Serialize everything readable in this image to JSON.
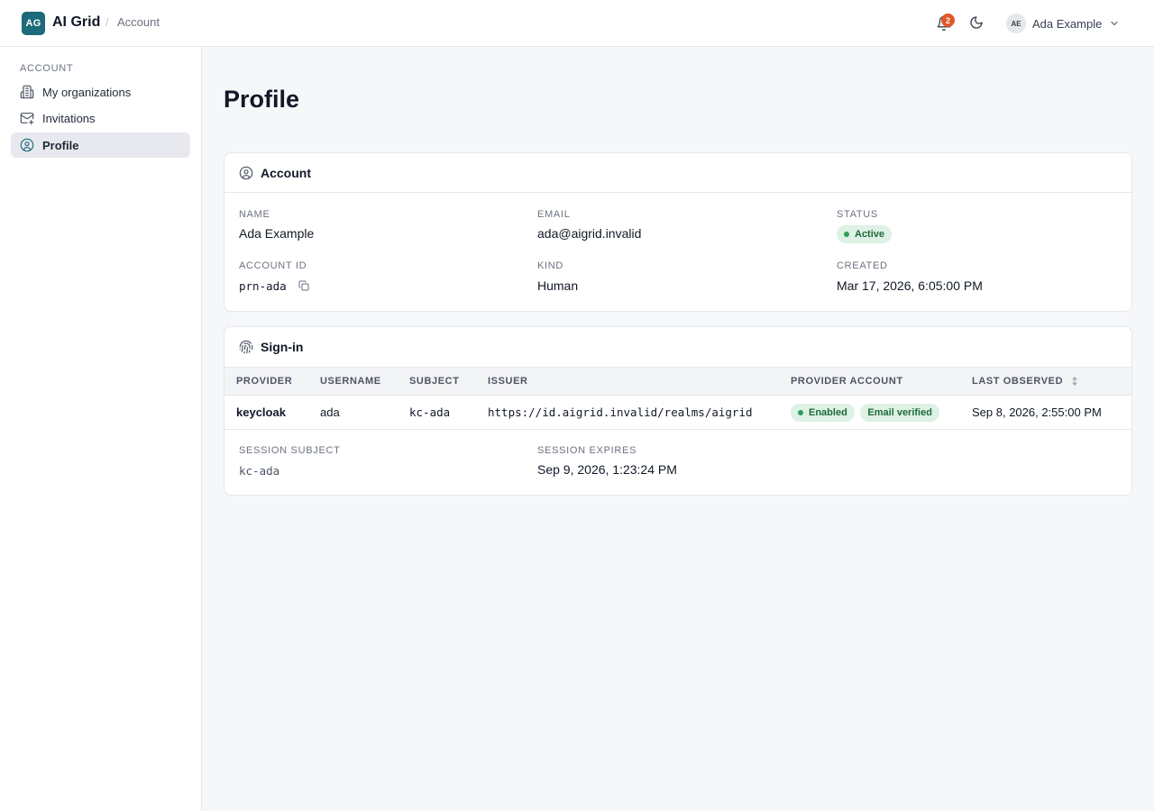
{
  "app": {
    "logo": "AG",
    "name": "AI Grid",
    "breadcrumb_sep": "/",
    "breadcrumb": "Account"
  },
  "header": {
    "notifications_count": "2",
    "user": {
      "initials": "AE",
      "name": "Ada Example"
    },
    "icons": {
      "bell": "bell-icon",
      "theme": "moon-icon",
      "menu": "chevron-down-icon"
    }
  },
  "sidebar": {
    "heading": "ACCOUNT",
    "items": [
      {
        "label": "My organizations",
        "icon": "building-icon",
        "active": false
      },
      {
        "label": "Invitations",
        "icon": "mail-icon",
        "active": false
      },
      {
        "label": "Profile",
        "icon": "user-circle-icon",
        "active": true
      }
    ]
  },
  "page": {
    "title": "Profile"
  },
  "account": {
    "title": "Account",
    "fields": {
      "name": {
        "label": "NAME",
        "value": "Ada Example"
      },
      "email": {
        "label": "EMAIL",
        "value": "ada@aigrid.invalid"
      },
      "status": {
        "label": "STATUS",
        "value": "Active"
      },
      "account_id": {
        "label": "ACCOUNT ID",
        "value": "prn-ada"
      },
      "kind": {
        "label": "KIND",
        "value": "Human"
      },
      "created": {
        "label": "CREATED",
        "value": "Mar 17, 2026, 6:05:00 PM"
      }
    }
  },
  "signin": {
    "title": "Sign-in",
    "columns": [
      "PROVIDER",
      "USERNAME",
      "SUBJECT",
      "ISSUER",
      "PROVIDER ACCOUNT",
      "LAST OBSERVED"
    ],
    "rows": [
      {
        "provider": "keycloak",
        "username": "ada",
        "subject": "kc-ada",
        "issuer": "https://id.aigrid.invalid/realms/aigrid",
        "badges": [
          "Enabled",
          "Email verified"
        ],
        "last_observed": "Sep 8, 2026, 2:55:00 PM"
      }
    ],
    "session_subject": {
      "label": "SESSION SUBJECT",
      "value": "kc-ada"
    },
    "session_expires": {
      "label": "SESSION EXPIRES",
      "value": "Sep 9, 2026, 1:23:24 PM"
    }
  },
  "colors": {
    "brand": "#1c6a7a",
    "badge_bg": "#ddf1e5",
    "badge_text": "#1f6b3b",
    "notification": "#e0592a"
  }
}
